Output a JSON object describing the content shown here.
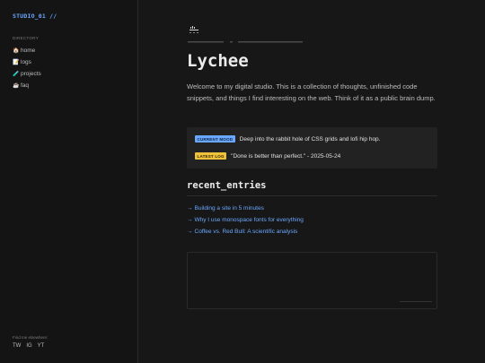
{
  "sidebar": {
    "brand": "STUDIO_01 //",
    "directory_label": "DIRECTORY",
    "items": [
      {
        "icon": "house-icon",
        "glyph": "🏠",
        "label": "home"
      },
      {
        "icon": "memo-icon",
        "glyph": "📝",
        "label": "logs"
      },
      {
        "icon": "test-tube-icon",
        "glyph": "🧪",
        "label": "projects"
      },
      {
        "icon": "coffee-icon",
        "glyph": "☕",
        "label": "faq"
      }
    ],
    "find_label": "Find me elsewhere:",
    "socials": [
      "TW",
      "IG",
      "YT"
    ]
  },
  "main": {
    "title": "Lychee",
    "intro": "Welcome to my digital studio. This is a collection of thoughts, unfinished code snippets, and things I find interesting on the web. Think of it as a public brain dump.",
    "status": {
      "mood_label": "CURRENT MOOD",
      "mood_text": "Deep into the rabbit hole of CSS grids and lofi hip hop.",
      "log_label": "LATEST LOG",
      "log_text": "\"Done is better than perfect.\" - 2025-05-24"
    },
    "recent_title": "recent_entries",
    "entries": [
      "Building a site in 5 minutes",
      "Why I use monospace fonts for everything",
      "Coffee vs. Red Bull: A scientific analysis"
    ]
  },
  "colors": {
    "accent": "#6aa8ff",
    "mood_badge": "#6aa8ff",
    "log_badge": "#f0c23c",
    "background": "#171717"
  }
}
